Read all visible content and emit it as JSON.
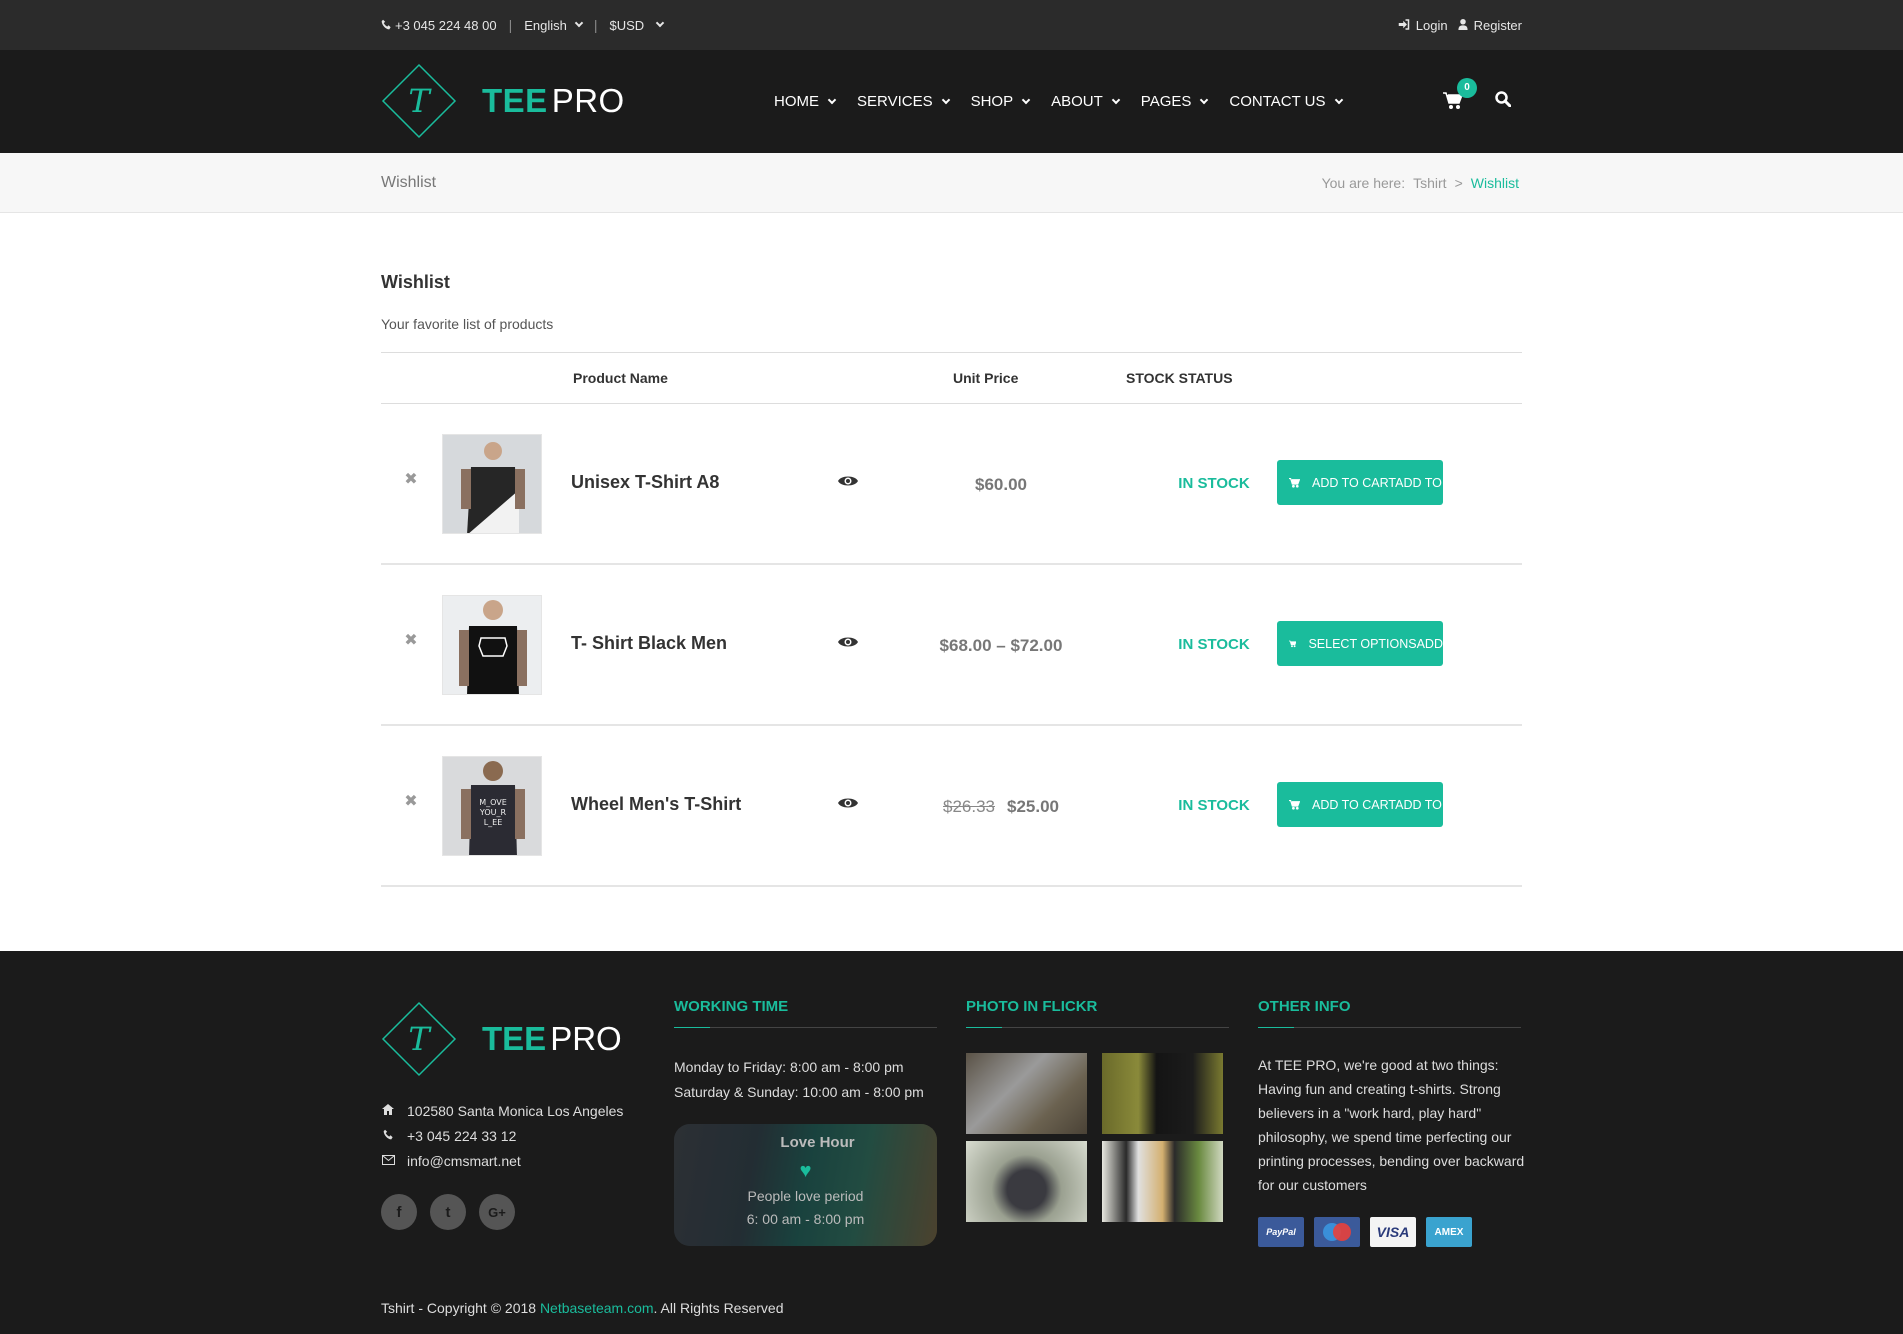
{
  "topbar": {
    "phone": "+3 045 224 48 00",
    "language": "English",
    "currency": "$USD",
    "login": "Login",
    "register": "Register"
  },
  "header": {
    "brand_bold": "TEE",
    "brand_light": "PRO",
    "logo_letter": "T",
    "nav": [
      {
        "label": "HOME"
      },
      {
        "label": "SERVICES"
      },
      {
        "label": "SHOP"
      },
      {
        "label": "ABOUT"
      },
      {
        "label": "PAGES"
      },
      {
        "label": "CONTACT US"
      }
    ],
    "cart_count": "0"
  },
  "breadcrumb": {
    "page_title": "Wishlist",
    "prefix": "You are here:",
    "items": [
      "Tshirt",
      "Wishlist"
    ],
    "separator": ">"
  },
  "wishlist": {
    "title": "Wishlist",
    "subtitle": "Your favorite list of products",
    "columns": {
      "product_name": "Product Name",
      "unit_price": "Unit Price",
      "stock_status": "STOCK STATUS"
    },
    "rows": [
      {
        "name": "Unisex T-Shirt A8",
        "price_old": "",
        "price": "$60.00",
        "stock": "IN STOCK",
        "button": "ADD TO CARTADD TO"
      },
      {
        "name": "T- Shirt Black Men",
        "price_old": "",
        "price": "$68.00 – $72.00",
        "stock": "IN STOCK",
        "button": "SELECT OPTIONSADD"
      },
      {
        "name": "Wheel Men's T-Shirt",
        "price_old": "$26.33",
        "price": "$25.00",
        "stock": "IN STOCK",
        "button": "ADD TO CARTADD TO"
      }
    ]
  },
  "footer": {
    "address": "102580 Santa Monica Los Angeles",
    "phone": "+3 045 224 33 12",
    "email": "info@cmsmart.net",
    "social": [
      "f",
      "t",
      "G+"
    ],
    "working_time": {
      "heading": "WORKING TIME",
      "weekday": "Monday to Friday: 8:00 am - 8:00 pm",
      "weekend": "Saturday & Sunday: 10:00 am - 8:00 pm",
      "love_title": "Love Hour",
      "love_sub": "People love period",
      "love_hours": "6: 00 am - 8:00 pm"
    },
    "flickr": {
      "heading": "PHOTO IN FLICKR"
    },
    "other_info": {
      "heading": "OTHER INFO",
      "text": "At TEE PRO, we're good at two things: Having fun and creating t-shirts. Strong believers in a \"work hard, play hard\" philosophy, we spend time perfecting our printing processes, bending over backward for our customers",
      "payments": [
        "PayPal",
        "Maestro",
        "VISA",
        "AMEX"
      ]
    },
    "copyright_prefix": "Tshirt - Copyright © 2018 ",
    "copyright_link": "Netbaseteam.com",
    "copyright_suffix": ". All Rights Reserved"
  },
  "colors": {
    "accent": "#1abc9c",
    "topbar_bg": "#2b2b2b",
    "header_bg": "#1b1b1b",
    "footer_bg": "#1b1b1b"
  }
}
